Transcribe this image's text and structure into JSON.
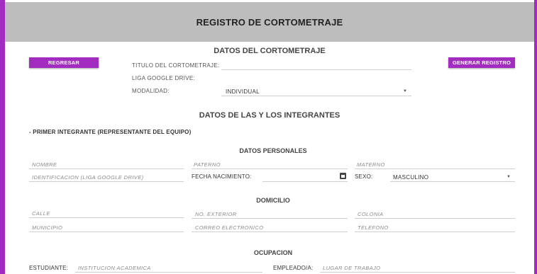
{
  "header": {
    "title": "REGISTRO DE CORTOMETRAJE"
  },
  "buttons": {
    "back": "REGRESAR",
    "generate": "GENERAR REGISTRO"
  },
  "film": {
    "section_title": "DATOS DEL CORTOMETRAJE",
    "title_label": "TITULO DEL CORTOMETRAJE:",
    "drive_label": "LIGA GOOGLE DRIVE:",
    "mode_label": "MODALIDAD:",
    "mode_value": "INDIVIDUAL"
  },
  "members": {
    "section_title": "DATOS DE LAS Y LOS INTEGRANTES",
    "first_member": "- PRIMER INTEGRANTE (REPRESENTANTE DEL EQUIPO)"
  },
  "personal": {
    "title": "DATOS PERSONALES",
    "name_ph": "NOMBRE",
    "paternal_ph": "PATERNO",
    "maternal_ph": "MATERNO",
    "id_ph": "IDENTIFICACION (LIGA GOOGLE DRIVE)",
    "birth_label": "FECHA NACIMIENTO:",
    "sex_label": "SEXO:",
    "sex_value": "MASCULINO"
  },
  "address": {
    "title": "DOMICILIO",
    "street_ph": "CALLE",
    "ext_ph": "NO. EXTERIOR",
    "colonia_ph": "COLONIA",
    "municipio_ph": "MUNICIPIO",
    "email_ph": "CORREO ELECTRONICO",
    "phone_ph": "TELEFONO"
  },
  "occupation": {
    "title": "OCUPACION",
    "student_label": "ESTUDIANTE:",
    "institution_ph": "INSTITUCION ACADEMICA",
    "employee_label": "EMPLEADO/A:",
    "workplace_ph": "LUGAR DE TRABAJO"
  },
  "icons": {
    "calendar": "calendar-icon",
    "dropdown": "caret-down-icon"
  },
  "colors": {
    "accent": "#a22cc0",
    "header_bg": "#bdbdbd"
  }
}
